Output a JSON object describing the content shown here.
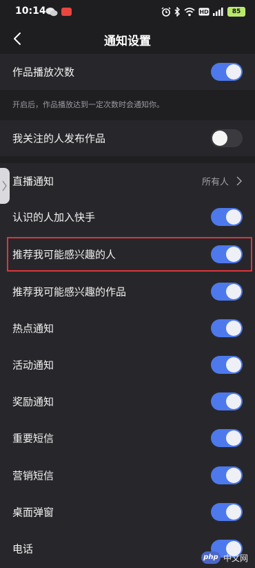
{
  "status_bar": {
    "time": "10:14",
    "battery": "85",
    "network": "HD"
  },
  "header": {
    "title": "通知设置"
  },
  "settings": {
    "play_count": {
      "label": "作品播放次数",
      "on": true
    },
    "play_count_hint": "开启后，作品播放达到一定次数时会通知你。",
    "followed_post": {
      "label": "我关注的人发布作品",
      "on": false
    },
    "live": {
      "label": "直播通知",
      "value": "所有人"
    },
    "acquaintance_join": {
      "label": "认识的人加入快手",
      "on": true
    },
    "recommend_people": {
      "label": "推荐我可能感兴趣的人",
      "on": true
    },
    "recommend_works": {
      "label": "推荐我可能感兴趣的作品",
      "on": true
    },
    "hot": {
      "label": "热点通知",
      "on": true
    },
    "activity": {
      "label": "活动通知",
      "on": true
    },
    "reward": {
      "label": "奖励通知",
      "on": true
    },
    "important_sms": {
      "label": "重要短信",
      "on": true
    },
    "marketing_sms": {
      "label": "营销短信",
      "on": true
    },
    "desktop_popup": {
      "label": "桌面弹窗",
      "on": true
    },
    "phone": {
      "label": "电话",
      "on": true
    }
  },
  "watermark": {
    "logo": "php",
    "text": "中文网"
  },
  "colors": {
    "accent": "#4d79ec",
    "highlight": "#e0343b",
    "background": "#27272b"
  }
}
